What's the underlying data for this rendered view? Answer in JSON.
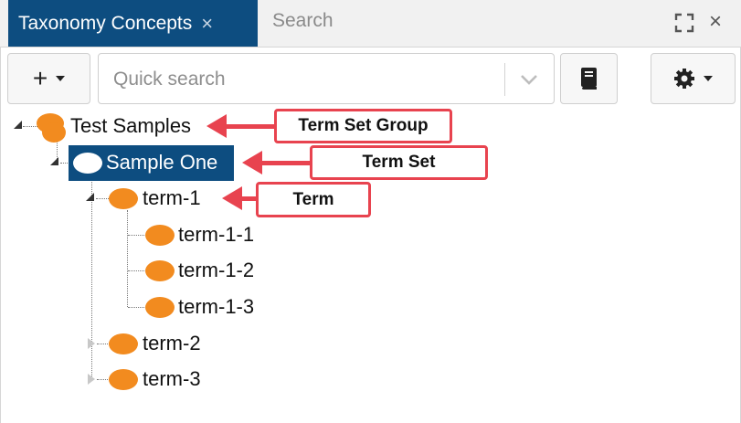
{
  "tabs": {
    "active_label": "Taxonomy Concepts",
    "active_close": "×",
    "search_label": "Search",
    "window_close": "×"
  },
  "toolbar": {
    "add_label": "+",
    "search_placeholder": "Quick search",
    "icons": [
      "plus-icon",
      "caret-down-icon",
      "chevron-down-icon",
      "book-icon",
      "gear-icon"
    ]
  },
  "tree": {
    "group_label": "Test Samples",
    "set_label": "Sample One",
    "term1_label": "term-1",
    "term1_1_label": "term-1-1",
    "term1_2_label": "term-1-2",
    "term1_3_label": "term-1-3",
    "term2_label": "term-2",
    "term3_label": "term-3"
  },
  "annotations": {
    "term_set_group": "Term Set Group",
    "term_set": "Term Set",
    "term": "Term"
  },
  "colors": {
    "accent": "#0d4d80",
    "term_icon": "#f28b1f",
    "annotation": "#e8434f"
  }
}
